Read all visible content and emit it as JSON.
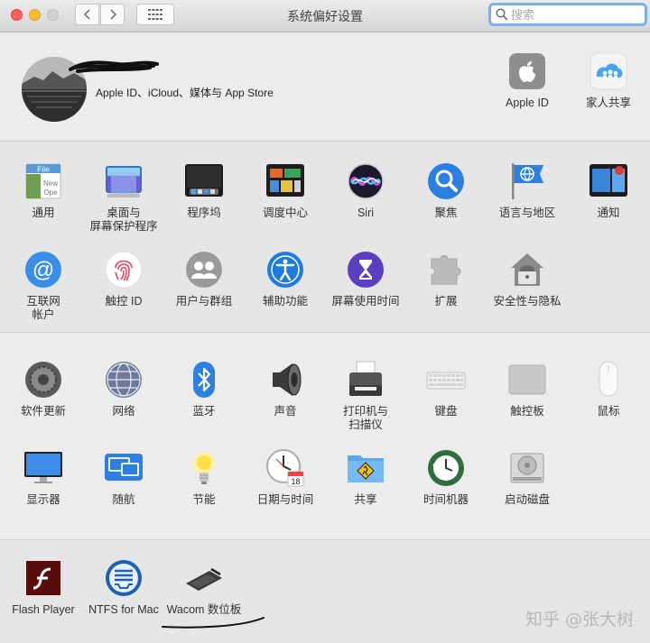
{
  "window": {
    "title": "系统偏好设置"
  },
  "search": {
    "placeholder": "搜索"
  },
  "account": {
    "label": "Apple ID、iCloud、媒体与 App Store"
  },
  "top_items": [
    {
      "label": "Apple ID",
      "icon": "apple-icon"
    },
    {
      "label": "家人共享",
      "icon": "family-sharing-icon"
    }
  ],
  "section1": [
    {
      "label": "通用",
      "icon": "general-icon"
    },
    {
      "label": "桌面与\n屏幕保护程序",
      "icon": "desktop-screensaver-icon"
    },
    {
      "label": "程序坞",
      "icon": "dock-icon"
    },
    {
      "label": "调度中心",
      "icon": "mission-control-icon"
    },
    {
      "label": "Siri",
      "icon": "siri-icon"
    },
    {
      "label": "聚焦",
      "icon": "spotlight-icon"
    },
    {
      "label": "语言与地区",
      "icon": "language-region-icon"
    },
    {
      "label": "通知",
      "icon": "notifications-icon"
    },
    {
      "label": "互联网\n帐户",
      "icon": "internet-accounts-icon"
    },
    {
      "label": "触控 ID",
      "icon": "touch-id-icon"
    },
    {
      "label": "用户与群组",
      "icon": "users-groups-icon"
    },
    {
      "label": "辅助功能",
      "icon": "accessibility-icon"
    },
    {
      "label": "屏幕使用时间",
      "icon": "screen-time-icon"
    },
    {
      "label": "扩展",
      "icon": "extensions-icon"
    },
    {
      "label": "安全性与隐私",
      "icon": "security-privacy-icon"
    }
  ],
  "section2": [
    {
      "label": "软件更新",
      "icon": "software-update-icon"
    },
    {
      "label": "网络",
      "icon": "network-icon"
    },
    {
      "label": "蓝牙",
      "icon": "bluetooth-icon"
    },
    {
      "label": "声音",
      "icon": "sound-icon"
    },
    {
      "label": "打印机与\n扫描仪",
      "icon": "printer-icon"
    },
    {
      "label": "键盘",
      "icon": "keyboard-icon"
    },
    {
      "label": "触控板",
      "icon": "trackpad-icon"
    },
    {
      "label": "鼠标",
      "icon": "mouse-icon"
    },
    {
      "label": "显示器",
      "icon": "displays-icon"
    },
    {
      "label": "随航",
      "icon": "sidecar-icon"
    },
    {
      "label": "节能",
      "icon": "energy-saver-icon"
    },
    {
      "label": "日期与时间",
      "icon": "date-time-icon"
    },
    {
      "label": "共享",
      "icon": "sharing-icon"
    },
    {
      "label": "时间机器",
      "icon": "time-machine-icon"
    },
    {
      "label": "启动磁盘",
      "icon": "startup-disk-icon"
    }
  ],
  "section3": [
    {
      "label": "Flash Player",
      "icon": "flash-player-icon"
    },
    {
      "label": "NTFS for Mac",
      "icon": "ntfs-icon"
    },
    {
      "label": "Wacom 数位板",
      "icon": "wacom-tablet-icon"
    }
  ],
  "calendar_day": "18",
  "watermark": "知乎 @张大树"
}
